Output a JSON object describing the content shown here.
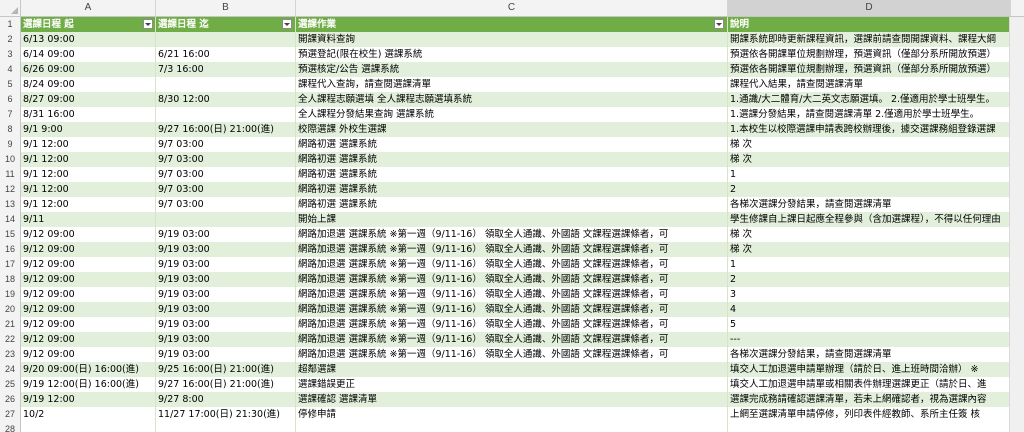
{
  "columns": [
    "A",
    "B",
    "C",
    "D"
  ],
  "header": {
    "a": "選課日程 起",
    "b": "選課日程 迄",
    "c": "選課作業",
    "d": "說明"
  },
  "rows": [
    {
      "n": "2",
      "a": "6/13  09:00",
      "b": "",
      "c": "開課資料查詢",
      "d": "開課系統即時更新課程資訊，選課前請查閱開課資料、課程大綱"
    },
    {
      "n": "3",
      "a": "6/14  09:00",
      "b": "6/21  16:00",
      "c": "預選登記(限在校生)  選課系統",
      "d": "預選依各開課單位規劃辦理，預選資訊（僅部分系所開放預選）"
    },
    {
      "n": "4",
      "a": "6/26  09:00",
      "b": "7/3  16:00",
      "c": "預選核定/公告  選課系統",
      "d": "預選依各開課單位規劃辦理，預選資訊（僅部分系所開放預選）"
    },
    {
      "n": "5",
      "a": "8/24  09:00",
      "b": "",
      "c": "課程代入查詢，請查閱選課清單",
      "d": "課程代入結果，請查閱選課清單"
    },
    {
      "n": "6",
      "a": "8/27  09:00",
      "b": "8/30  12:00",
      "c": "全人課程志願選填  全人課程志願選填系統",
      "d": "1.通識/大二體育/大二英文志願選填。  2.僅適用於學士班學生。"
    },
    {
      "n": "7",
      "a": "8/31  16:00",
      "b": "",
      "c": "全人課程分發結果查詢  選課系統",
      "d": "1.選課分發結果，請查閱選課清單  2.僅適用於學士班學生。"
    },
    {
      "n": "8",
      "a": "9/1  9:00",
      "b": "9/27  16:00(日)  21:00(進)",
      "c": "校際選課  外校生選課",
      "d": "1.本校生以校際選課申請表跨校辦理後，據交選課務組登錄選課"
    },
    {
      "n": "9",
      "a": "9/1  12:00",
      "b": "9/7  03:00",
      "c": "網路初選  選課系統",
      "d": "梯  次"
    },
    {
      "n": "10",
      "a": "9/1  12:00",
      "b": "9/7  03:00",
      "c": "網路初選  選課系統",
      "d": "梯  次"
    },
    {
      "n": "11",
      "a": "9/1  12:00",
      "b": "9/7  03:00",
      "c": "網路初選  選課系統",
      "d": "1"
    },
    {
      "n": "12",
      "a": "9/1  12:00",
      "b": "9/7  03:00",
      "c": "網路初選  選課系統",
      "d": "2"
    },
    {
      "n": "13",
      "a": "9/1  12:00",
      "b": "9/7  03:00",
      "c": "網路初選  選課系統",
      "d": "各梯次選課分發結果，請查閱選課清單"
    },
    {
      "n": "14",
      "a": "9/11",
      "b": "",
      "c": "開始上課",
      "d": "學生修課自上課日起應全程參與（含加選課程），不得以任何理由"
    },
    {
      "n": "15",
      "a": "9/12  09:00",
      "b": "9/19  03:00",
      "c": "網路加退選  選課系統     ※第一週（9/11-16）  領取全人通識、外國語  文課程選課條者，可",
      "d": "梯  次"
    },
    {
      "n": "16",
      "a": "9/12  09:00",
      "b": "9/19  03:00",
      "c": "網路加退選  選課系統     ※第一週（9/11-16）  領取全人通識、外國語  文課程選課條者，可",
      "d": "梯  次"
    },
    {
      "n": "17",
      "a": "9/12  09:00",
      "b": "9/19  03:00",
      "c": "網路加退選  選課系統     ※第一週（9/11-16）  領取全人通識、外國語  文課程選課條者，可",
      "d": "1"
    },
    {
      "n": "18",
      "a": "9/12  09:00",
      "b": "9/19  03:00",
      "c": "網路加退選  選課系統     ※第一週（9/11-16）  領取全人通識、外國語  文課程選課條者，可",
      "d": "2"
    },
    {
      "n": "19",
      "a": "9/12  09:00",
      "b": "9/19  03:00",
      "c": "網路加退選  選課系統     ※第一週（9/11-16）  領取全人通識、外國語  文課程選課條者，可",
      "d": "3"
    },
    {
      "n": "20",
      "a": "9/12  09:00",
      "b": "9/19  03:00",
      "c": "網路加退選  選課系統     ※第一週（9/11-16）  領取全人通識、外國語  文課程選課條者，可",
      "d": "4"
    },
    {
      "n": "21",
      "a": "9/12  09:00",
      "b": "9/19  03:00",
      "c": "網路加退選  選課系統     ※第一週（9/11-16）  領取全人通識、外國語  文課程選課條者，可",
      "d": "5"
    },
    {
      "n": "22",
      "a": "9/12  09:00",
      "b": "9/19  03:00",
      "c": "網路加退選  選課系統     ※第一週（9/11-16）  領取全人通識、外國語  文課程選課條者，可",
      "d": "---"
    },
    {
      "n": "23",
      "a": "9/12  09:00",
      "b": "9/19  03:00",
      "c": "網路加退選  選課系統     ※第一週（9/11-16）  領取全人通識、外國語  文課程選課條者，可",
      "d": "各梯次選課分發結果，請查閱選課清單"
    },
    {
      "n": "24",
      "a": "9/20  09:00(日)  16:00(進)",
      "b": "9/25  16:00(日)  21:00(進)",
      "c": "超鄰選課",
      "d": "填交人工加退選申請單辦理（請於日、進上班時間洽辦）   ※"
    },
    {
      "n": "25",
      "a": "9/19  12:00(日)  16:00(進)",
      "b": "9/27  16:00(日)  21:00(進)",
      "c": "選課錯誤更正",
      "d": "填交人工加退選申請單或相關表件辦理選課更正（請於日、進"
    },
    {
      "n": "26",
      "a": "9/19  12:00",
      "b": "9/27  8:00",
      "c": "選課確認  選課清單",
      "d": "選課完成務請確認選課清單，若未上網確認者，視為選課內容"
    },
    {
      "n": "27",
      "a": "10/2",
      "b": "11/27  17:00(日)  21:30(進)",
      "c": "停修申請",
      "d": "上網至選課清單申請停修，列印表件經教師、系所主任簽  核"
    }
  ],
  "blank_rows": [
    "28"
  ]
}
